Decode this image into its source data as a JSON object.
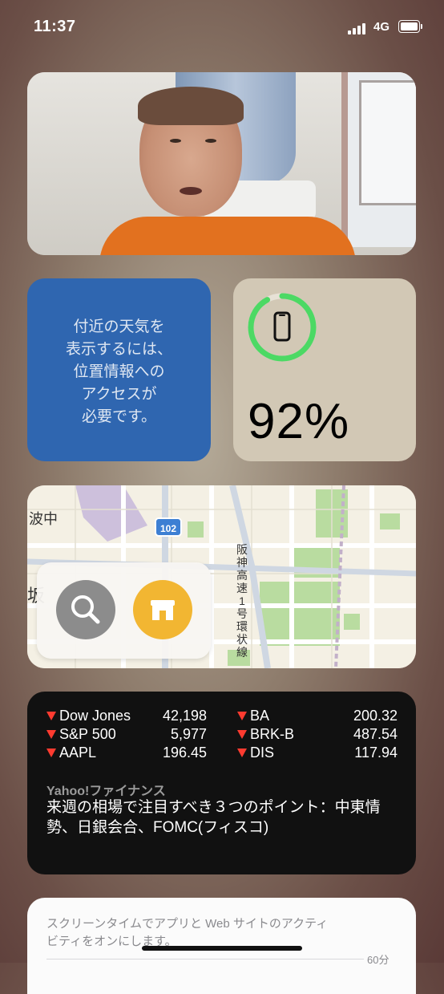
{
  "status_bar": {
    "time": "11:37",
    "network": "4G"
  },
  "photo_widget": {
    "icon": "person-photo"
  },
  "weather_widget": {
    "message": "付近の天気を\n表示するには、\n位置情報への\nアクセスが\n必要です。",
    "color": "#2f66b0"
  },
  "battery_widget": {
    "percent_text": "92%",
    "level": 0.92,
    "ring_color": "#4cd964",
    "icon": "iphone-icon"
  },
  "map_widget": {
    "route_badge": "102",
    "place_label_left": "波中",
    "place_label_edge": "坂",
    "road_label": "阪神高速1号環状線",
    "buttons": [
      {
        "icon": "search-icon"
      },
      {
        "icon": "store-icon"
      }
    ]
  },
  "stocks_widget": {
    "down_color": "#ff3b30",
    "left_column": [
      {
        "symbol": "Dow Jones",
        "value": "42,198"
      },
      {
        "symbol": "S&P 500",
        "value": "5,977"
      },
      {
        "symbol": "AAPL",
        "value": "196.45"
      }
    ],
    "right_column": [
      {
        "symbol": "BA",
        "value": "200.32"
      },
      {
        "symbol": "BRK-B",
        "value": "487.54"
      },
      {
        "symbol": "DIS",
        "value": "117.94"
      }
    ],
    "news_source": "Yahoo!ファイナンス",
    "news_title": "来週の相場で注目すべき３つのポイント：中東情勢、日銀会合、FOMC(フィスコ)"
  },
  "screentime_widget": {
    "message": "スクリーンタイムでアプリと Web サイトのアクティビティをオンにします。",
    "axis_label": "60分"
  }
}
